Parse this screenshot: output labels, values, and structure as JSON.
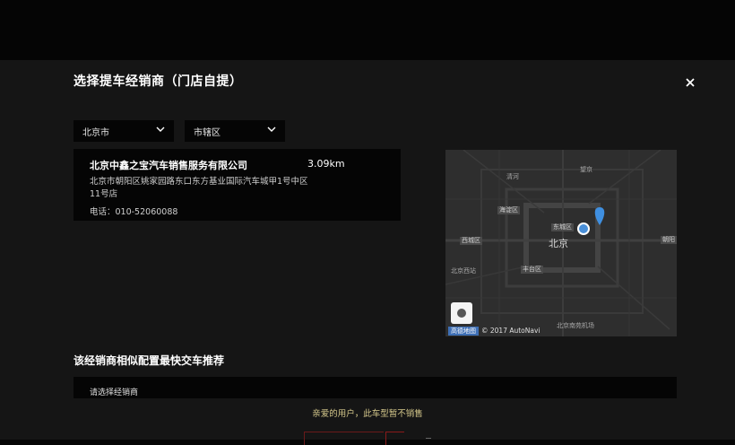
{
  "modal": {
    "title": "选择提车经销商（门店自提）"
  },
  "filters": {
    "city": "北京市",
    "district": "市辖区"
  },
  "dealer": {
    "name": "北京中鑫之宝汽车销售服务有限公司",
    "distance": "3.09km",
    "address": "北京市朝阳区姚家园路东口东方基业国际汽车城甲1号中区11号店",
    "phone": "电话：010-52060088"
  },
  "map": {
    "city_label": "北京",
    "district_labels": [
      "海淀区",
      "东城区",
      "西城区",
      "北京西站",
      "丰台区",
      "朝阳"
    ],
    "place_labels": [
      "清河",
      "望京",
      "北京南苑机场"
    ],
    "credit_logo": "高德地图",
    "credit_text": "© 2017 AutoNavi",
    "colors": {
      "pin": "#3f8fe0",
      "current_location": "#4a90d9",
      "background": "#2e2e2e"
    }
  },
  "recommend": {
    "title": "该经销商相似配置最快交车推荐",
    "dealer_placeholder": "请选择经销商",
    "notice": "亲爱的用户，此车型暂不销售"
  }
}
